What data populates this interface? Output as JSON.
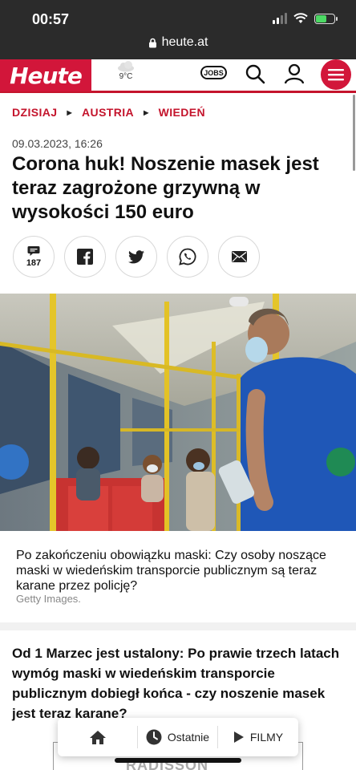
{
  "status_bar": {
    "time": "00:57",
    "url": "heute.at"
  },
  "header": {
    "logo": "Heute",
    "weather_temp": "9°C",
    "jobs_label": "JOBS",
    "brand_color": "#d2163a"
  },
  "breadcrumb": [
    "DZISIAJ",
    "AUSTRIA",
    "WIEDEŃ"
  ],
  "article": {
    "date": "09.03.2023, 16:26",
    "title": "Corona huk! Noszenie masek jest teraz zagrożone grzywną w wysokości 150 euro",
    "comment_count": "187",
    "share_icons": [
      "comment-icon",
      "facebook-icon",
      "twitter-icon",
      "whatsapp-icon",
      "mail-icon"
    ],
    "photo_caption": "Po zakończeniu obowiązku maski: Czy osoby noszące maski w wiedeńskim transporcie publicznym są teraz karane przez policję?",
    "photo_credit": "Getty Images.",
    "lead": "Od 1 Marzec jest ustalony: Po prawie trzech latach wymóg maski w wiedeńskim transporcie publicznym dobiegł końca - czy noszenie masek jest teraz karane?"
  },
  "ad": {
    "text": "RADISSON"
  },
  "bottom_nav": {
    "home_icon": "home-icon",
    "recent_label": "Ostatnie",
    "films_label": "FILMY"
  }
}
